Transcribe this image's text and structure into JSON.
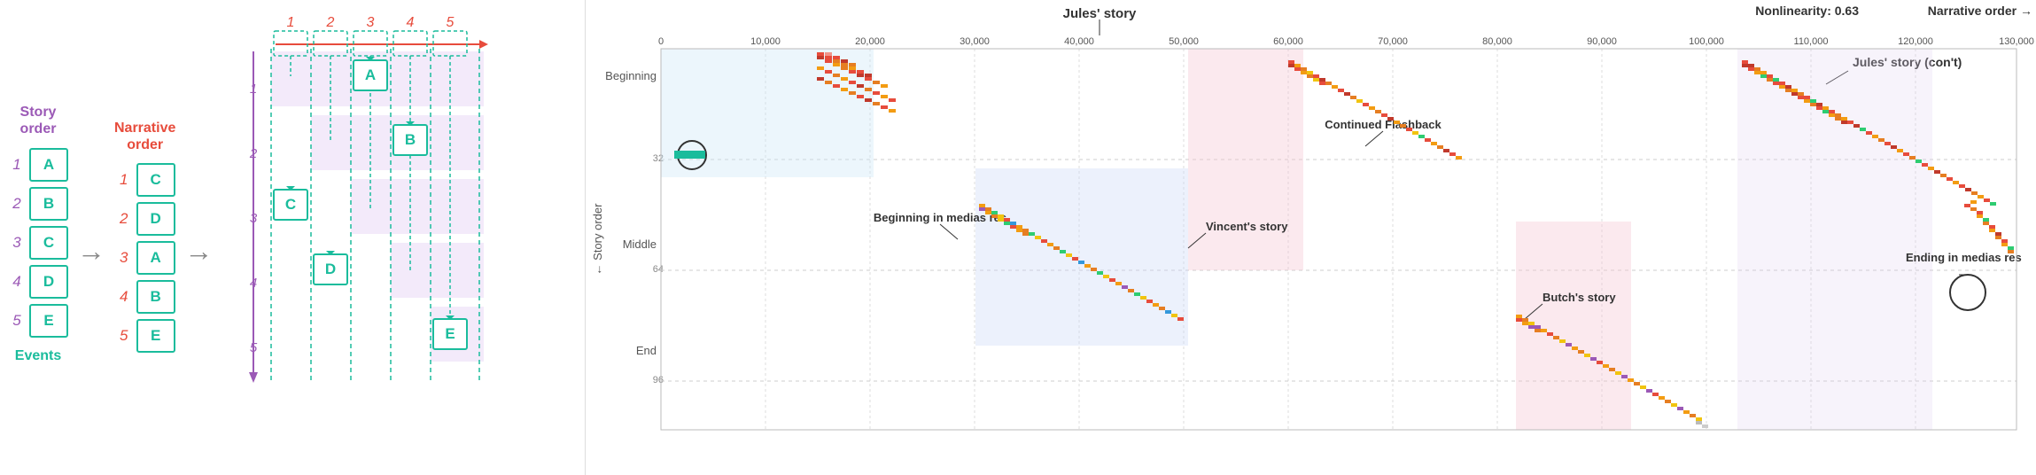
{
  "left": {
    "story_order_title": "Story\norder",
    "narrative_order_title": "Narrative\norder",
    "events_label": "Events",
    "story_items": [
      {
        "num": "1",
        "letter": "A"
      },
      {
        "num": "2",
        "letter": "B"
      },
      {
        "num": "3",
        "letter": "C"
      },
      {
        "num": "4",
        "letter": "D"
      },
      {
        "num": "5",
        "letter": "E"
      }
    ],
    "narrative_nums": [
      "1",
      "2",
      "3",
      "4",
      "5"
    ],
    "narrative_letters": [
      "C",
      "D",
      "A",
      "B",
      "E"
    ],
    "diagram_nums": [
      "1",
      "2",
      "3",
      "4",
      "5"
    ],
    "diagram_letters_positions": [
      {
        "letter": "A",
        "col": 3,
        "row": 1
      },
      {
        "letter": "B",
        "col": 4,
        "row": 2
      },
      {
        "letter": "C",
        "col": 1,
        "row": 3
      },
      {
        "letter": "D",
        "col": 2,
        "row": 4
      },
      {
        "letter": "E",
        "col": 5,
        "row": 5
      }
    ]
  },
  "chart": {
    "nonlinearity": "Nonlinearity: 0.63",
    "narrative_order": "Narrative order →",
    "title_jules": "Jules' story",
    "title_jules_cont": "Jules' story (con't)",
    "label_beginning_medias": "Beginning in medias res",
    "label_continued_flashback": "Continued Flashback",
    "label_vincents_story": "Vincent's story",
    "label_ending_medias": "Ending in medias res",
    "label_butchs_story": "Butch's story",
    "y_labels": [
      "Beginning",
      "Middle",
      "End"
    ],
    "y_ticks": [
      "32",
      "64",
      "96"
    ],
    "x_ticks": [
      "0",
      "10,000",
      "20,000",
      "30,000",
      "40,000",
      "50,000",
      "60,000",
      "70,000",
      "80,000",
      "90,000",
      "100,000",
      "110,000",
      "120,000",
      "130,000"
    ],
    "story_order_axis": "← Story order"
  }
}
